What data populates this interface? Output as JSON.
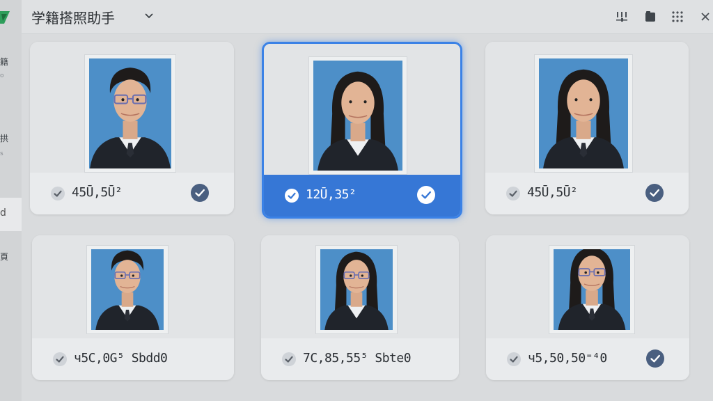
{
  "app": {
    "title": "学籍搭照助手",
    "logo_icon": "app-logo-icon",
    "accent": "#3677d6"
  },
  "sidebar": {
    "glyphs": [
      "籍",
      "o",
      "拱",
      "s",
      "d",
      "頁"
    ]
  },
  "header": {
    "buttons": [
      {
        "name": "filter-settings-icon"
      },
      {
        "name": "folder-icon"
      },
      {
        "name": "grid-view-icon"
      },
      {
        "name": "close-icon"
      }
    ]
  },
  "photos": [
    {
      "size": "45Ū,5Ū²",
      "checked": false,
      "verified": true,
      "selected": false,
      "person": "male-glasses"
    },
    {
      "size": "12Ū,35²",
      "checked": true,
      "verified": true,
      "selected": true,
      "person": "female"
    },
    {
      "size": "45Ū,5Ū²",
      "checked": false,
      "verified": true,
      "selected": false,
      "person": "female-tie"
    },
    {
      "size": "ч5C,0G⁵ Sbdd0",
      "checked": false,
      "verified": false,
      "selected": false,
      "person": "male-glasses-2"
    },
    {
      "size": "7C,85,55⁵ Sbte0",
      "checked": false,
      "verified": false,
      "selected": false,
      "person": "female-glasses"
    },
    {
      "size": "ч5,50,50⁼⁴0",
      "checked": false,
      "verified": true,
      "selected": false,
      "person": "female-glasses-tie"
    }
  ]
}
